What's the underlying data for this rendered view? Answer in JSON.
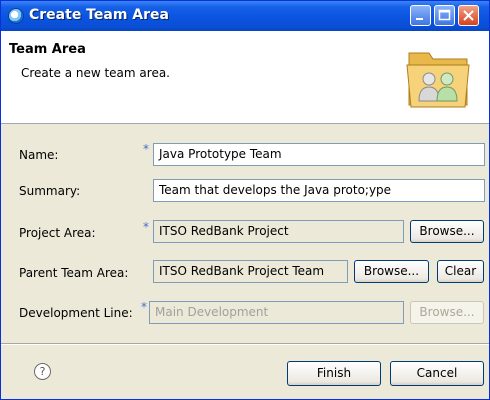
{
  "window": {
    "title": "Create Team Area",
    "controls": {
      "minimize": "minimize",
      "maximize": "maximize",
      "close": "close"
    }
  },
  "banner": {
    "title": "Team Area",
    "description": "Create a new team area.",
    "icon": "team-area-icon"
  },
  "form": {
    "name": {
      "label": "Name:",
      "required": "*",
      "value": "Java Prototype Team"
    },
    "summary": {
      "label": "Summary:",
      "value": "Team that develops the Java proto;ype"
    },
    "project_area": {
      "label": "Project Area:",
      "required": "*",
      "value": "ITSO RedBank Project",
      "browse": "Browse..."
    },
    "parent_team_area": {
      "label": "Parent Team Area:",
      "value": "ITSO RedBank Project Team",
      "browse": "Browse...",
      "clear": "Clear"
    },
    "development_line": {
      "label": "Development Line:",
      "required": "*",
      "value": "Main Development",
      "browse": "Browse..."
    }
  },
  "footer": {
    "help": "?",
    "finish": "Finish",
    "cancel": "Cancel"
  },
  "colors": {
    "titlebar": "#0a54e0",
    "dialog_bg": "#ece9d8",
    "required_marker": "#4a6bd0",
    "field_border": "#7f9db9"
  }
}
